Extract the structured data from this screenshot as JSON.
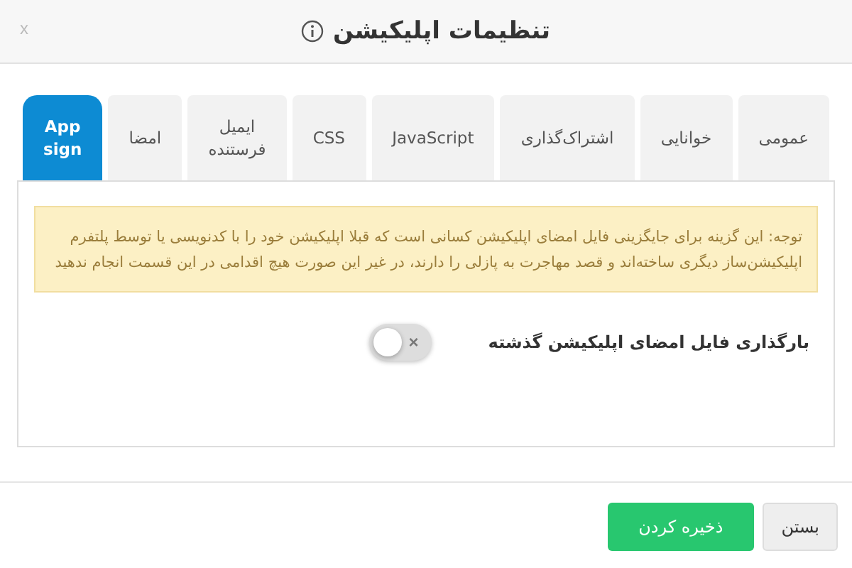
{
  "dialog": {
    "title": "تنظیمات اپلیکیشن",
    "close": "x"
  },
  "tabs": [
    {
      "label": "عمومی",
      "selected": false
    },
    {
      "label": "خوانایی",
      "selected": false
    },
    {
      "label": "اشتراک‌گذاری",
      "selected": false
    },
    {
      "label": "JavaScript",
      "selected": false
    },
    {
      "label": "CSS",
      "selected": false
    },
    {
      "label": "ایمیل فرستنده",
      "selected": false
    },
    {
      "label": "امضا",
      "selected": false
    },
    {
      "label": "App sign",
      "selected": true
    }
  ],
  "notice": "توجه: این گزینه برای جایگزینی فایل امضای اپلیکیشن کسانی است که قبلا اپلیکیشن خود را با کدنویسی یا توسط پلتفرم اپلیکیشن‌ساز دیگری ساخته‌اند و قصد مهاجرت به پازلی را دارند، در غیر این صورت هیچ اقدامی در این قسمت انجام ندهید",
  "setting": {
    "label": "بارگذاری فایل امضای اپلیکیشن گذشته",
    "on": false,
    "off_mark": "×"
  },
  "buttons": [
    {
      "label": "بستن",
      "kind": "secondary"
    },
    {
      "label": "ذخیره کردن",
      "kind": "primary"
    }
  ]
}
